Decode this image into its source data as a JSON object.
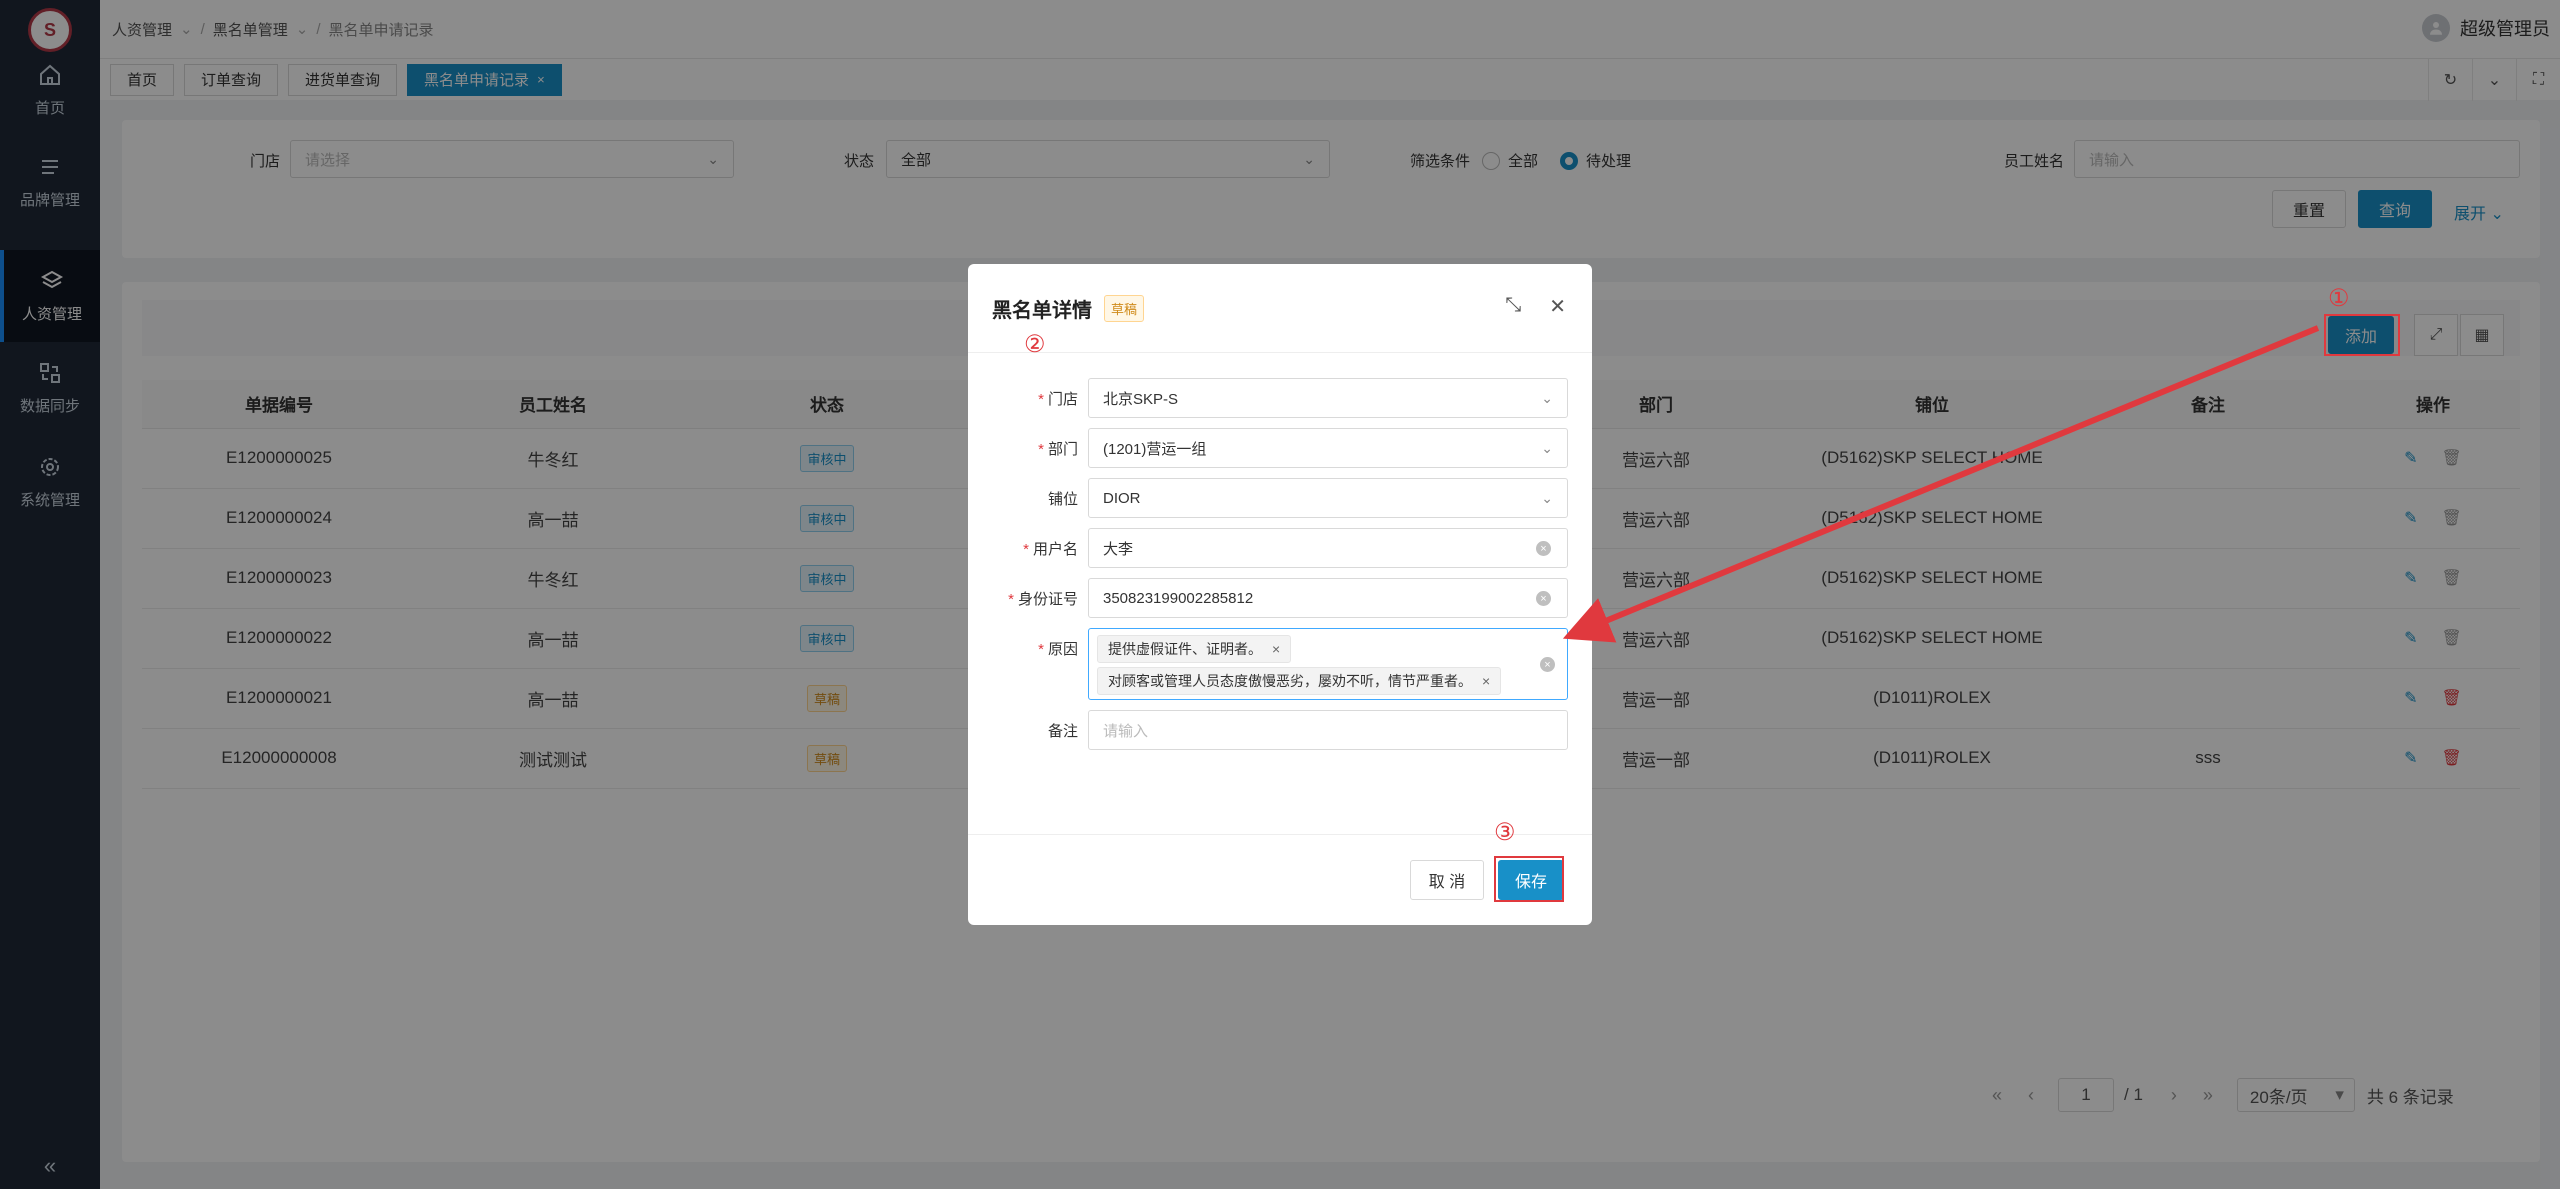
{
  "sidebar": {
    "items": [
      {
        "label": "首页",
        "icon": "home-icon"
      },
      {
        "label": "品牌管理",
        "icon": "list-icon"
      },
      {
        "label": "人资管理",
        "icon": "layers-icon",
        "active": true
      },
      {
        "label": "数据同步",
        "icon": "sync-icon"
      },
      {
        "label": "系统管理",
        "icon": "gear-icon"
      }
    ],
    "collapse": "«"
  },
  "header": {
    "breadcrumb": [
      "人资管理",
      "黑名单管理",
      "黑名单申请记录"
    ],
    "user": "超级管理员"
  },
  "tabs": [
    "首页",
    "订单查询",
    "进货单查询",
    "黑名单申请记录"
  ],
  "filter": {
    "store_label": "门店",
    "store_placeholder": "请选择",
    "status_label": "状态",
    "status_value": "全部",
    "condition_label": "筛选条件",
    "condition_all": "全部",
    "condition_pending": "待处理",
    "condition_selected": "待处理",
    "employee_label": "员工姓名",
    "employee_placeholder": "请输入",
    "reset": "重置",
    "query": "查询",
    "expand": "展开"
  },
  "table": {
    "add_button": "添加",
    "columns": [
      "单据编号",
      "员工姓名",
      "状态",
      "",
      "部门",
      "铺位",
      "备注",
      "操作"
    ],
    "rows": [
      {
        "id": "E1200000025",
        "name": "牛冬红",
        "status": "审核中",
        "status_type": "review",
        "dept": "营运六部",
        "shop": "(D5162)SKP SELECT HOME",
        "note": "",
        "deletable": false
      },
      {
        "id": "E1200000024",
        "name": "高一喆",
        "status": "审核中",
        "status_type": "review",
        "dept": "营运六部",
        "shop": "(D5162)SKP SELECT HOME",
        "note": "",
        "deletable": false
      },
      {
        "id": "E1200000023",
        "name": "牛冬红",
        "status": "审核中",
        "status_type": "review",
        "dept": "营运六部",
        "shop": "(D5162)SKP SELECT HOME",
        "note": "",
        "deletable": false
      },
      {
        "id": "E1200000022",
        "name": "高一喆",
        "status": "审核中",
        "status_type": "review",
        "dept": "营运六部",
        "shop": "(D5162)SKP SELECT HOME",
        "note": "",
        "deletable": false
      },
      {
        "id": "E1200000021",
        "name": "高一喆",
        "status": "草稿",
        "status_type": "draft",
        "dept": "营运一部",
        "shop": "(D1011)ROLEX",
        "note": "",
        "deletable": true
      },
      {
        "id": "E12000000008",
        "name": "测试测试",
        "status": "草稿",
        "status_type": "draft",
        "dept": "营运一部",
        "shop": "(D1011)ROLEX",
        "note": "sss",
        "deletable": true
      }
    ]
  },
  "pager": {
    "first": "«",
    "prev": "‹",
    "page": "1",
    "total_pages": "/ 1",
    "next": "›",
    "last": "»",
    "page_size": "20条/页",
    "total": "共 6 条记录"
  },
  "modal": {
    "title": "黑名单详情",
    "badge": "草稿",
    "fields": {
      "store_label": "门店",
      "store_value": "北京SKP-S",
      "dept_label": "部门",
      "dept_value": "(1201)营运一组",
      "shop_label": "铺位",
      "shop_value": "DIOR",
      "username_label": "用户名",
      "username_value": "大李",
      "idcard_label": "身份证号",
      "idcard_value": "350823199002285812",
      "reason_label": "原因",
      "reason_tags": [
        "提供虚假证件、证明者。",
        "对顾客或管理人员态度傲慢恶劣，屡劝不听，情节严重者。"
      ],
      "note_label": "备注",
      "note_placeholder": "请输入"
    },
    "cancel": "取 消",
    "save": "保存"
  },
  "annotations": {
    "n1": "①",
    "n2": "②",
    "n3": "③",
    "color": "#e0393e"
  }
}
